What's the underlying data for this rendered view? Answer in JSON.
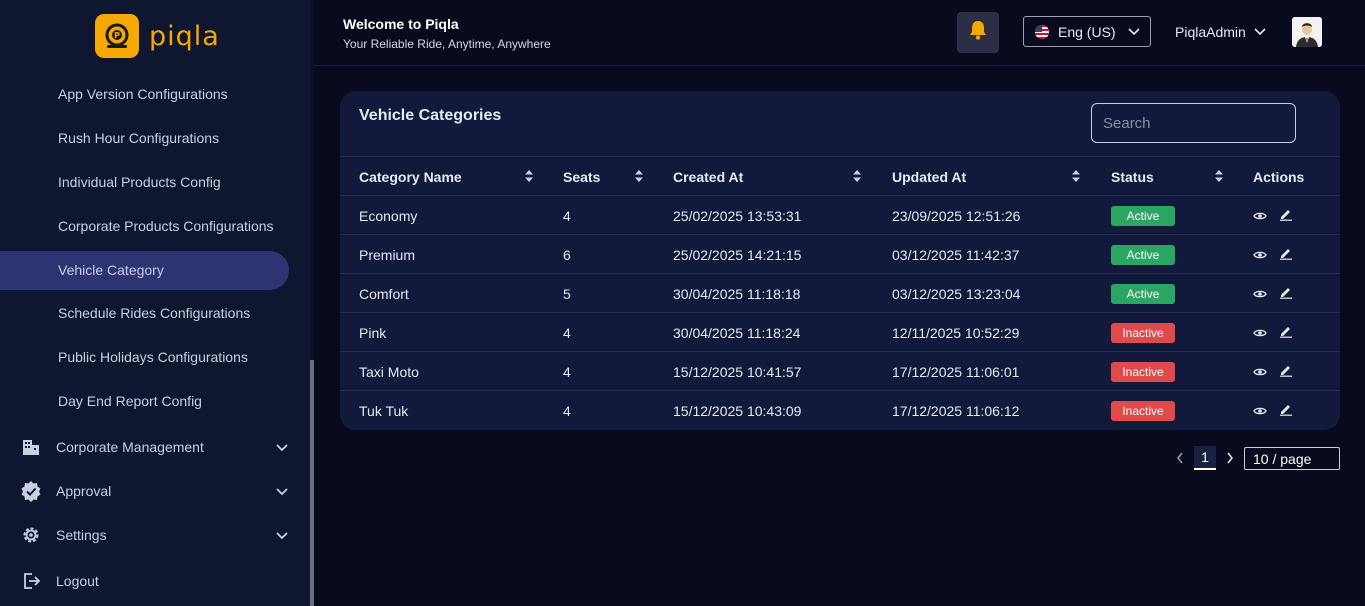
{
  "app": {
    "logo_text": "piqla",
    "brand_color": "#f5a800"
  },
  "sidebar": {
    "sub_items": [
      {
        "label": "App Version Configurations"
      },
      {
        "label": "Rush Hour Configurations"
      },
      {
        "label": "Individual Products Config"
      },
      {
        "label": "Corporate Products Configurations"
      },
      {
        "label": "Vehicle Category",
        "active": true
      },
      {
        "label": "Schedule Rides Configurations"
      },
      {
        "label": "Public Holidays Configurations"
      },
      {
        "label": "Day End Report Config"
      }
    ],
    "groups": [
      {
        "label": "Corporate Management",
        "icon": "building-icon"
      },
      {
        "label": "Approval",
        "icon": "verified-badge-icon"
      },
      {
        "label": "Settings",
        "icon": "gear-icon"
      },
      {
        "label": "Logout",
        "icon": "logout-icon"
      }
    ]
  },
  "header": {
    "title": "Welcome to Piqla",
    "subtitle": "Your Reliable Ride, Anytime, Anywhere",
    "language": "Eng (US)",
    "user": "PiqlaAdmin"
  },
  "card": {
    "title": "Vehicle Categories",
    "search_placeholder": "Search",
    "columns": [
      "Category Name",
      "Seats",
      "Created At",
      "Updated At",
      "Status",
      "Actions"
    ],
    "rows": [
      {
        "name": "Economy",
        "seats": "4",
        "created": "25/02/2025 13:53:31",
        "updated": "23/09/2025 12:51:26",
        "status": "Active"
      },
      {
        "name": "Premium",
        "seats": "6",
        "created": "25/02/2025 14:21:15",
        "updated": "03/12/2025 11:42:37",
        "status": "Active"
      },
      {
        "name": "Comfort",
        "seats": "5",
        "created": "30/04/2025 11:18:18",
        "updated": "03/12/2025 13:23:04",
        "status": "Active"
      },
      {
        "name": "Pink",
        "seats": "4",
        "created": "30/04/2025 11:18:24",
        "updated": "12/11/2025 10:52:29",
        "status": "Inactive"
      },
      {
        "name": "Taxi Moto",
        "seats": "4",
        "created": "15/12/2025 10:41:57",
        "updated": "17/12/2025 11:06:01",
        "status": "Inactive"
      },
      {
        "name": "Tuk Tuk",
        "seats": "4",
        "created": "15/12/2025 10:43:09",
        "updated": "17/12/2025 11:06:12",
        "status": "Inactive"
      }
    ]
  },
  "pagination": {
    "current_page": "1",
    "page_size": "10 / page"
  },
  "colors": {
    "active": "#2aa564",
    "inactive": "#e04a4a",
    "selected_nav": "#2e3372"
  }
}
